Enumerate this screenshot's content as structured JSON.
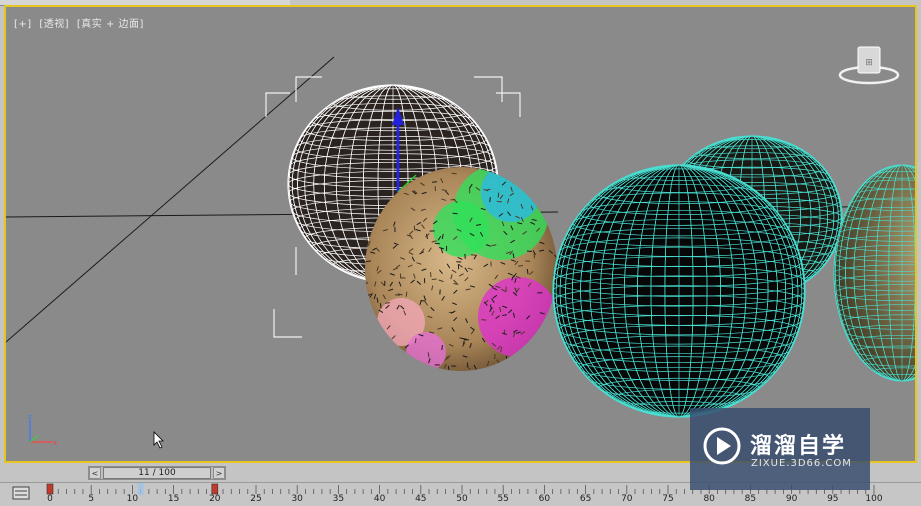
{
  "viewport": {
    "label_plus": "[+]",
    "label_view": "[透视]",
    "label_shading": "[真实 + 边面]",
    "border_color": "#e6c51e",
    "background_color": "#8a8a8a"
  },
  "time_slider": {
    "prev_label": "<",
    "next_label": ">",
    "current": "11 / 100",
    "current_frame": 11,
    "total_frames": 100
  },
  "trackbar": {
    "tick_labels": [
      "0",
      "5",
      "10",
      "15",
      "20",
      "25",
      "30",
      "35",
      "40",
      "45",
      "50",
      "55",
      "60",
      "65",
      "70",
      "75",
      "80",
      "85",
      "90",
      "95",
      "100"
    ],
    "keyframes": [
      0,
      20
    ]
  },
  "watermark": {
    "name": "溜溜自学",
    "url": "ZIXUE.3D66.COM"
  },
  "icons": {
    "viewcube": "viewcube-icon",
    "cursor": "mouse-pointer-icon",
    "gizmo": "xyz-axis-icon",
    "trackbar": "mini-curve-editor-icon",
    "watermark_logo": "play-logo-icon"
  },
  "colors": {
    "wire_white": "#ffffff",
    "wire_teal": "#49e0d2",
    "accent_yellow": "#e6c51e",
    "keyframe_red": "#c0392b"
  }
}
